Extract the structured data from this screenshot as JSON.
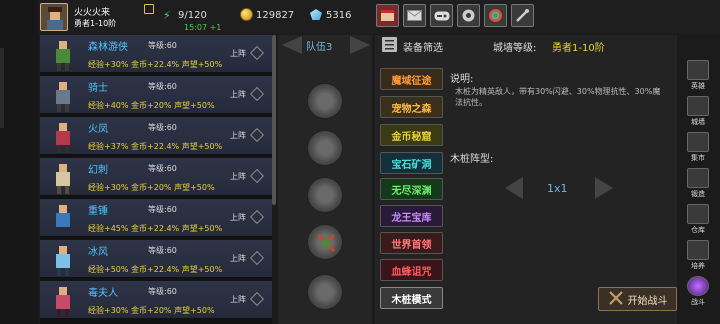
{
  "player": {
    "name": "火火火来",
    "rank": "勇者1-10阶",
    "energy": "9/120",
    "energy_timer": "15:07 +1",
    "gold": "129827",
    "gems": "5316"
  },
  "heroes": [
    {
      "name": "森林游侠",
      "level": "等级:60",
      "exp": "经验+30%",
      "gold": "金币+22.4%",
      "fame": "声望+50%",
      "status": "上阵",
      "color": "#4a8a3a"
    },
    {
      "name": "骑士",
      "level": "等级:60",
      "exp": "经验+40%",
      "gold": "金币+20%",
      "fame": "声望+50%",
      "status": "上阵",
      "color": "#6a7a8a"
    },
    {
      "name": "火凤",
      "level": "等级:60",
      "exp": "经验+37%",
      "gold": "金币+22.4%",
      "fame": "声望+50%",
      "status": "上阵",
      "color": "#b23a4a"
    },
    {
      "name": "幻刺",
      "level": "等级:60",
      "exp": "经验+30%",
      "gold": "金币+20%",
      "fame": "声望+50%",
      "status": "上阵",
      "color": "#d6c6a0"
    },
    {
      "name": "重锤",
      "level": "等级:60",
      "exp": "经验+45%",
      "gold": "金币+22.4%",
      "fame": "声望+50%",
      "status": "上阵",
      "color": "#3a7ab8"
    },
    {
      "name": "冰风",
      "level": "等级:60",
      "exp": "经验+50%",
      "gold": "金币+22.4%",
      "fame": "声望+50%",
      "status": "上阵",
      "color": "#7ac0e8"
    },
    {
      "name": "毒夫人",
      "level": "等级:60",
      "exp": "经验+30%",
      "gold": "金币+20%",
      "fame": "声望+50%",
      "status": "上阵",
      "color": "#c84a6a"
    }
  ],
  "team": {
    "label": "队伍3"
  },
  "filter": {
    "label": "装备筛选",
    "wall_label": "城墙等级:",
    "wall_level": "勇者1-10阶"
  },
  "modes": [
    {
      "label": "魔域征途",
      "color": "#ff9a3a",
      "bg": "#3a2a1a"
    },
    {
      "label": "宠物之森",
      "color": "#ffb84a",
      "bg": "#3a2f1a"
    },
    {
      "label": "金币秘窟",
      "color": "#e8d23a",
      "bg": "#3a3a14"
    },
    {
      "label": "宝石矿洞",
      "color": "#4ae0e0",
      "bg": "#14303a"
    },
    {
      "label": "无尽深渊",
      "color": "#6aef6a",
      "bg": "#143a1a"
    },
    {
      "label": "龙王宝库",
      "color": "#c88aff",
      "bg": "#2a1a3a"
    },
    {
      "label": "世界首领",
      "color": "#ff7a7a",
      "bg": "#3a1a1a"
    },
    {
      "label": "血蜂诅咒",
      "color": "#ff5a5a",
      "bg": "#3a141a"
    },
    {
      "label": "木桩模式",
      "color": "#ffffff",
      "bg": "#3a3a3a"
    }
  ],
  "description": {
    "title": "说明:",
    "text": "木桩为精英敌人，带有30%闪避、30%物理抗性、30%魔法抗性。"
  },
  "formation": {
    "title": "木桩阵型:",
    "value": "1x1"
  },
  "start_button": "开始战斗",
  "right_nav": [
    {
      "label": "英雄",
      "icon": "hero-icon"
    },
    {
      "label": "城墙",
      "icon": "wall-icon"
    },
    {
      "label": "集市",
      "icon": "market-icon"
    },
    {
      "label": "锻造",
      "icon": "forge-icon"
    },
    {
      "label": "仓库",
      "icon": "warehouse-icon"
    },
    {
      "label": "培养",
      "icon": "train-icon"
    },
    {
      "label": "战斗",
      "icon": "battle-icon"
    }
  ],
  "top_buttons": [
    "shop-icon",
    "mail-icon",
    "gamepad-icon",
    "settings-icon",
    "skin-icon",
    "tools-icon"
  ]
}
